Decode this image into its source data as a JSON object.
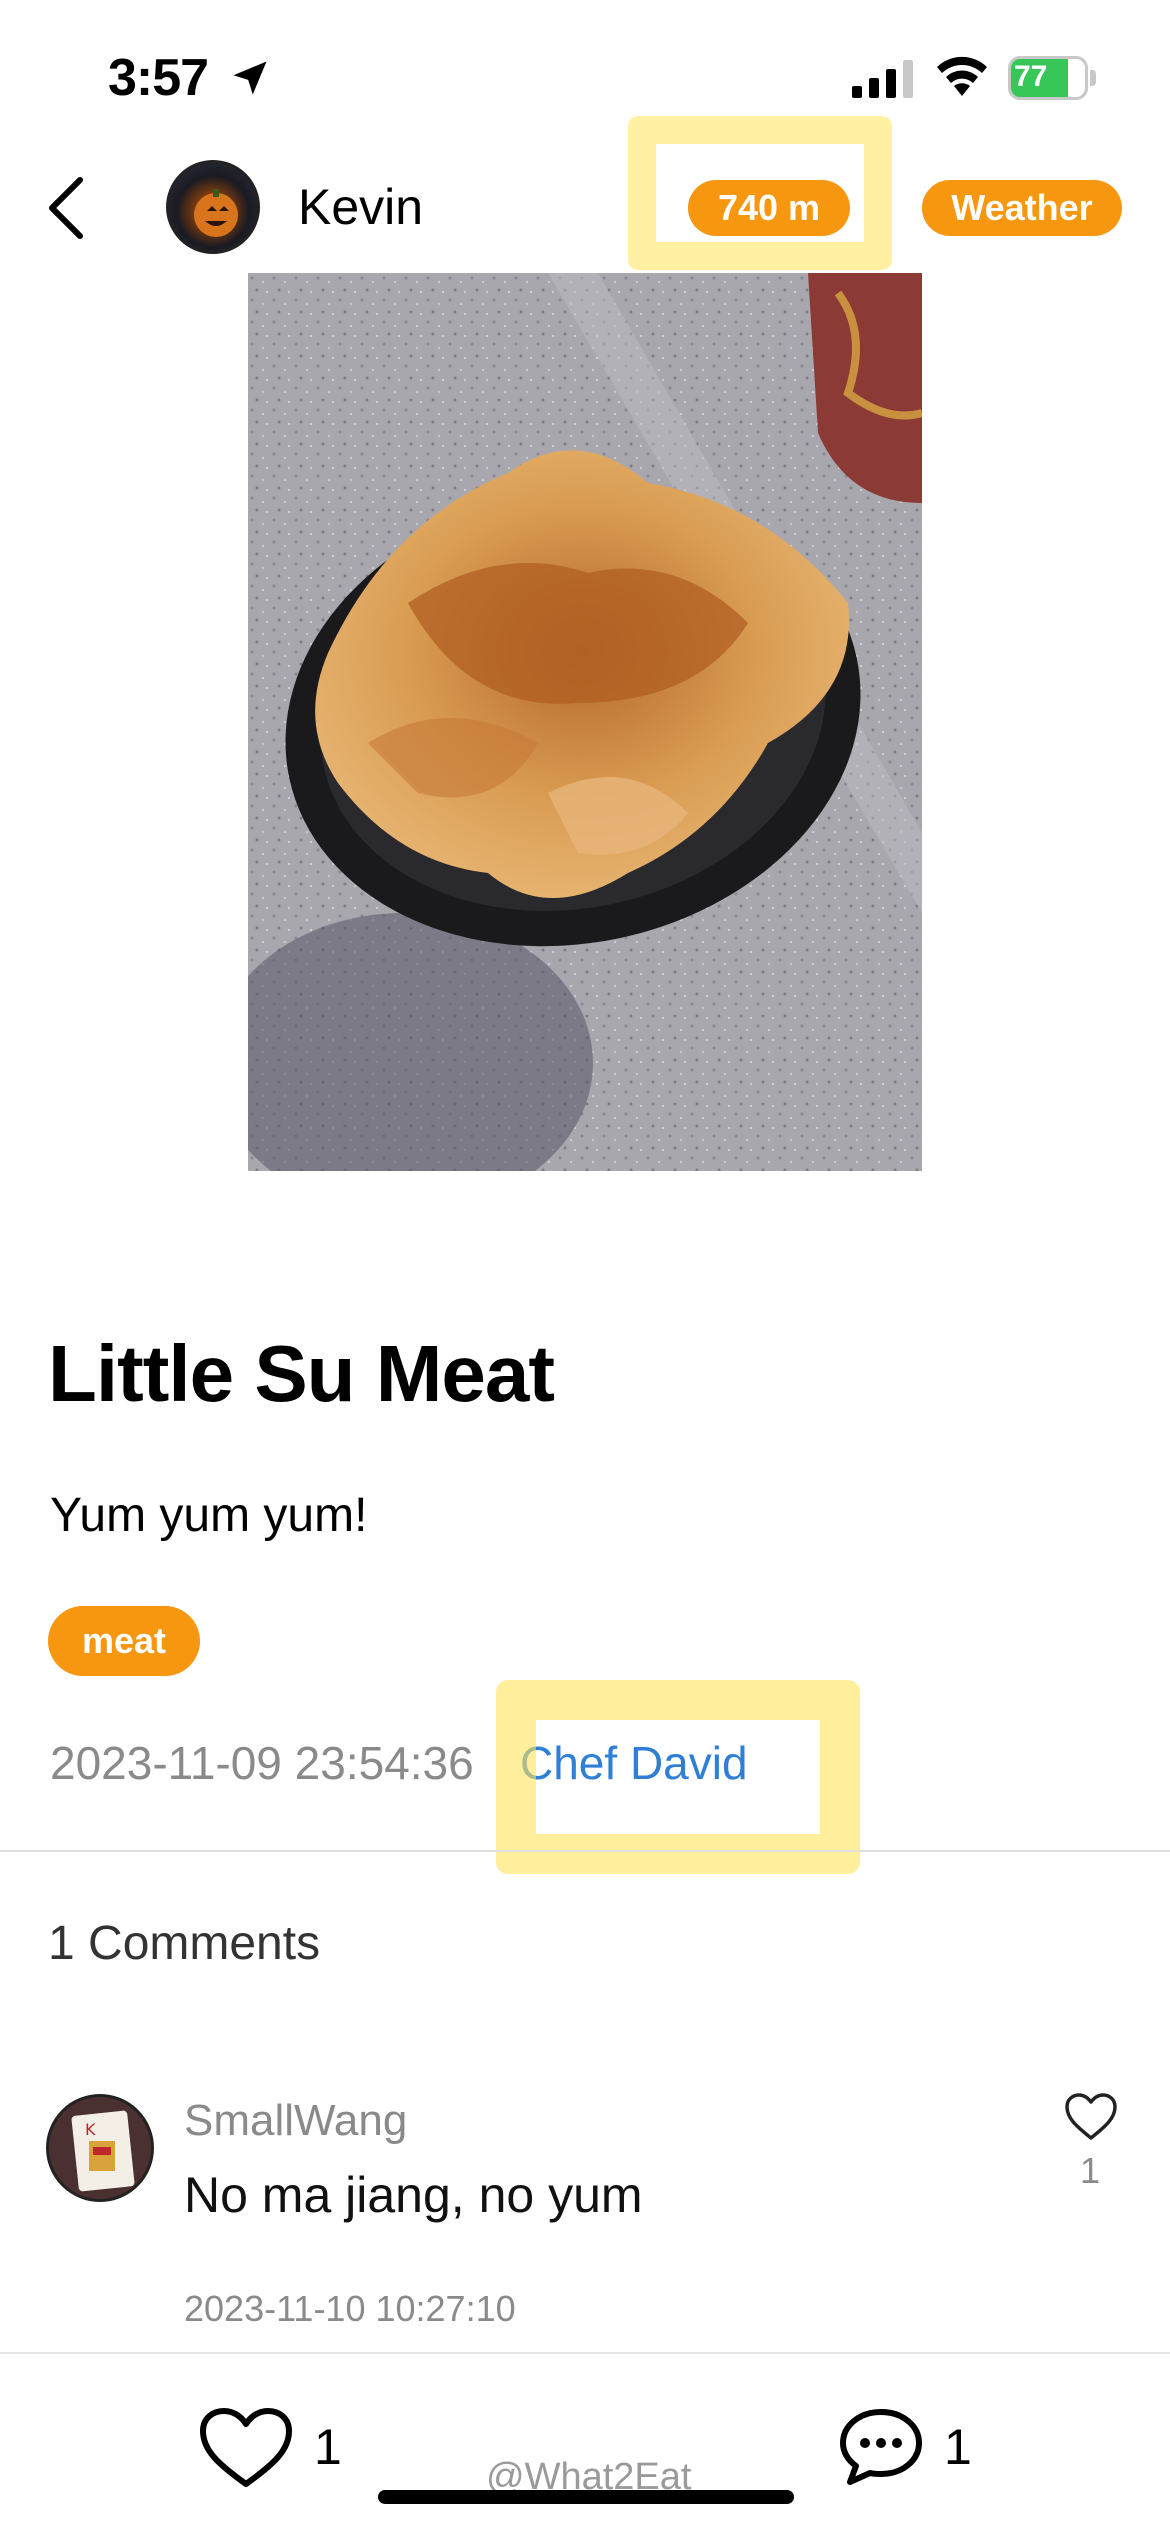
{
  "status_bar": {
    "time": "3:57",
    "battery_percent": 77,
    "battery_label": "77"
  },
  "header": {
    "username": "Kevin",
    "distance": "740 m",
    "weather": "Weather"
  },
  "post": {
    "title": "Little Su Meat",
    "description": "Yum yum yum!",
    "tag": "meat",
    "timestamp": "2023-11-09 23:54:36",
    "chef": "Chef David"
  },
  "comments": {
    "count_label": "1 Comments",
    "items": [
      {
        "user": "SmallWang",
        "text": "No ma jiang, no yum",
        "time": "2023-11-10 10:27:10",
        "likes": "1"
      }
    ]
  },
  "bottom_bar": {
    "likes": "1",
    "comments": "1",
    "watermark": "@What2Eat"
  },
  "colors": {
    "accent": "#f7960f",
    "link": "#2f7fd6",
    "highlight": "#ffe35a",
    "battery": "#37c759"
  }
}
